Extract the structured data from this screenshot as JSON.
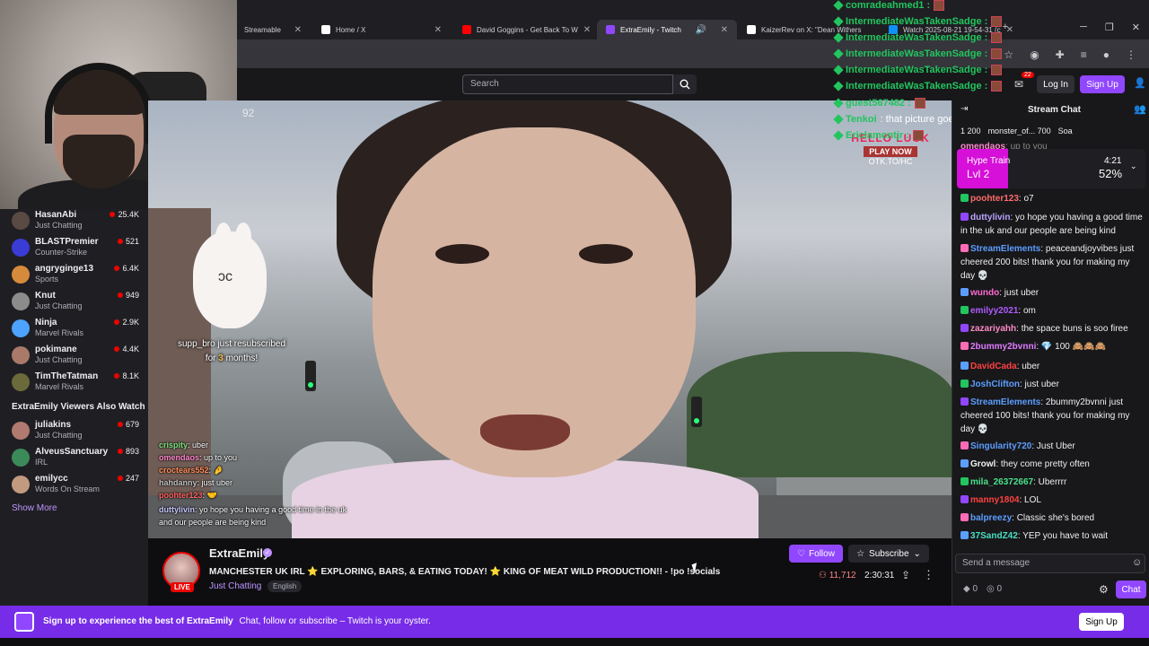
{
  "browser": {
    "tabs": [
      {
        "label": "Streamable",
        "icon_color": "#0f90fa"
      },
      {
        "label": "Home / X",
        "icon_color": "#ffffff"
      },
      {
        "label": "David Goggins - Get Back To W",
        "icon_color": "#ff0000"
      },
      {
        "label": "ExtraEmily - Twitch",
        "icon_color": "#9147ff"
      },
      {
        "label": "KaizerRev on X: \"Dean Withers",
        "icon_color": "#ffffff"
      },
      {
        "label": "Watch 2025-08-21 19-54-31 (c",
        "icon_color": "#0f90fa"
      }
    ],
    "new_tab": "+"
  },
  "topnav": {
    "search_placeholder": "Search",
    "notif_count": "22",
    "login": "Log In",
    "signup": "Sign Up"
  },
  "sidebar": {
    "channels": [
      {
        "name": "HasanAbi",
        "game": "Just Chatting",
        "viewers": "25.4K",
        "color": "#5a4a44"
      },
      {
        "name": "BLASTPremier",
        "game": "Counter-Strike",
        "viewers": "521",
        "color": "#3b3bd6"
      },
      {
        "name": "angryginge13",
        "game": "Sports",
        "viewers": "6.4K",
        "color": "#d88a3c"
      },
      {
        "name": "Knut",
        "game": "Just Chatting",
        "viewers": "949",
        "color": "#8c8c8c"
      },
      {
        "name": "Ninja",
        "game": "Marvel Rivals",
        "viewers": "2.9K",
        "color": "#4da3ff"
      },
      {
        "name": "pokimane",
        "game": "Just Chatting",
        "viewers": "4.4K",
        "color": "#a97a6a"
      },
      {
        "name": "TimTheTatman",
        "game": "Marvel Rivals",
        "viewers": "8.1K",
        "color": "#6a6a3a"
      }
    ],
    "section_title": "ExtraEmily Viewers Also Watch",
    "also_watch": [
      {
        "name": "juliakins",
        "game": "Just Chatting",
        "viewers": "679",
        "color": "#b07a70"
      },
      {
        "name": "AlveusSanctuary",
        "game": "IRL",
        "viewers": "893",
        "color": "#3b8a5a"
      },
      {
        "name": "emilycc",
        "game": "Words On Stream",
        "viewers": "247",
        "color": "#c29a80"
      }
    ],
    "show_more": "Show More"
  },
  "video": {
    "counter": "92",
    "resub_user": "supp_bro",
    "resub_text": "just resubscribed",
    "resub_for": "for",
    "resub_months": "3",
    "resub_months_word": "months!",
    "ad": {
      "line1": "HELLO LUCK",
      "line2": "PLAY NOW",
      "line3": "OTK.TO/HC"
    },
    "chat": [
      {
        "user": "crispity",
        "text": ": uber",
        "color": "#7ee07e"
      },
      {
        "user": "omendaos",
        "text": ": up to you",
        "color": "#ff88cc"
      },
      {
        "user": "croctears552",
        "text": ": 🤌",
        "color": "#ff8c5a"
      },
      {
        "user": "hahdanny",
        "text": ": just uber",
        "color": "#c0c0c0"
      },
      {
        "user": "poohter123",
        "text": ": 🤝",
        "color": "#ff6060"
      },
      {
        "user": "duttylivin",
        "text": ": yo hope you having a good time in the uk and our people are being kind",
        "color": "#c8c8ff"
      }
    ]
  },
  "overlay_chat": [
    {
      "user": "comradeahmed1 :",
      "color": "#22c55e"
    },
    {
      "user": "IntermediateWasTakenSadge :",
      "color": "#22c55e"
    },
    {
      "user": "IntermediateWasTakenSadge :",
      "color": "#22c55e"
    },
    {
      "user": "IntermediateWasTakenSadge :",
      "color": "#22c55e"
    },
    {
      "user": "IntermediateWasTakenSadge :",
      "color": "#22c55e"
    },
    {
      "user": "IntermediateWasTakenSadge :",
      "color": "#22c55e"
    },
    {
      "user": "guest567482 :",
      "color": "#22c55e"
    },
    {
      "user": "Tenkoi",
      "text": ": that picture goes hard ngl",
      "color": "#22c55e"
    },
    {
      "user": "Ericlamontjr :",
      "color": "#22c55e"
    }
  ],
  "stream": {
    "name": "ExtraEmily",
    "title": "MANCHESTER UK IRL ⭐ EXPLORING, BARS, & EATING TODAY! ⭐ KING OF MEAT WILD PRODUCTION!! - !po !socials",
    "category": "Just Chatting",
    "language": "English",
    "live": "LIVE",
    "follow": "Follow",
    "subscribe": "Subscribe",
    "viewers": "11,712",
    "uptime": "2:30:31"
  },
  "chat": {
    "title": "Stream Chat",
    "leaderboard": [
      {
        "rank": "1",
        "value": "200"
      },
      {
        "name": "monster_of...",
        "value": "700"
      },
      {
        "name": "Soa"
      }
    ],
    "top_partial": {
      "user": "omendaos",
      "text": ": up to you"
    },
    "hype": {
      "title": "Hype Train",
      "level": "Lvl 2",
      "time": "4:21",
      "percent": "52%",
      "progress": 0.52
    },
    "messages": [
      {
        "user": "poohter123",
        "text": ": o7",
        "color": "#ff6b6b"
      },
      {
        "user": "duttylivin",
        "text": ": yo hope you having a good time in the uk and our people are being kind",
        "color": "#b9a3ff"
      },
      {
        "user": "StreamElements",
        "text": ": peaceandjoyvibes just cheered 200 bits! thank you for making my day 💀",
        "color": "#5c9eff"
      },
      {
        "user": "wundo",
        "text": ": just uber",
        "color": "#ff69d1"
      },
      {
        "user": "emilyy2021",
        "text": ": om",
        "color": "#b05cff"
      },
      {
        "user": "zazariyahh",
        "text": ": the space buns is soo firee",
        "color": "#ff8ac5"
      },
      {
        "user": "2bummy2bvnni",
        "text": ": 💎 100 🙈🙈🙈",
        "color": "#e07cff"
      },
      {
        "user": "DavidCada",
        "text": ": uber",
        "color": "#ff4040"
      },
      {
        "user": "JoshClifton",
        "text": ": just uber",
        "color": "#5c9eff"
      },
      {
        "user": "StreamElements",
        "text": ": 2bummy2bvnni just cheered 100 bits! thank you for making my day 💀",
        "color": "#5c9eff"
      },
      {
        "user": "Singularity720",
        "text": ": Just Uber",
        "color": "#5c9eff"
      },
      {
        "user": "Growl",
        "text": ": they come pretty often",
        "color": "#efeff1"
      },
      {
        "user": "mila_26372667",
        "text": ": Uberrrr",
        "color": "#4ae08a"
      },
      {
        "user": "manny1804",
        "text": ": LOL",
        "color": "#ff4040"
      },
      {
        "user": "balpreezy",
        "text": ": Classic she's bored",
        "color": "#5c9eff"
      },
      {
        "user": "37SandZ42",
        "text": ": YEP you have to wait",
        "color": "#4ae0c0"
      }
    ],
    "input_placeholder": "Send a message",
    "points_a": "0",
    "points_b": "0",
    "chat_button": "Chat"
  },
  "banner": {
    "bold": "Sign up to experience the best of ExtraEmily",
    "text": "Chat, follow or subscribe – Twitch is your oyster.",
    "signup": "Sign Up"
  },
  "colors": {
    "brand": "#9147ff",
    "live": "#eb0400",
    "hype": "#d60fd9"
  }
}
